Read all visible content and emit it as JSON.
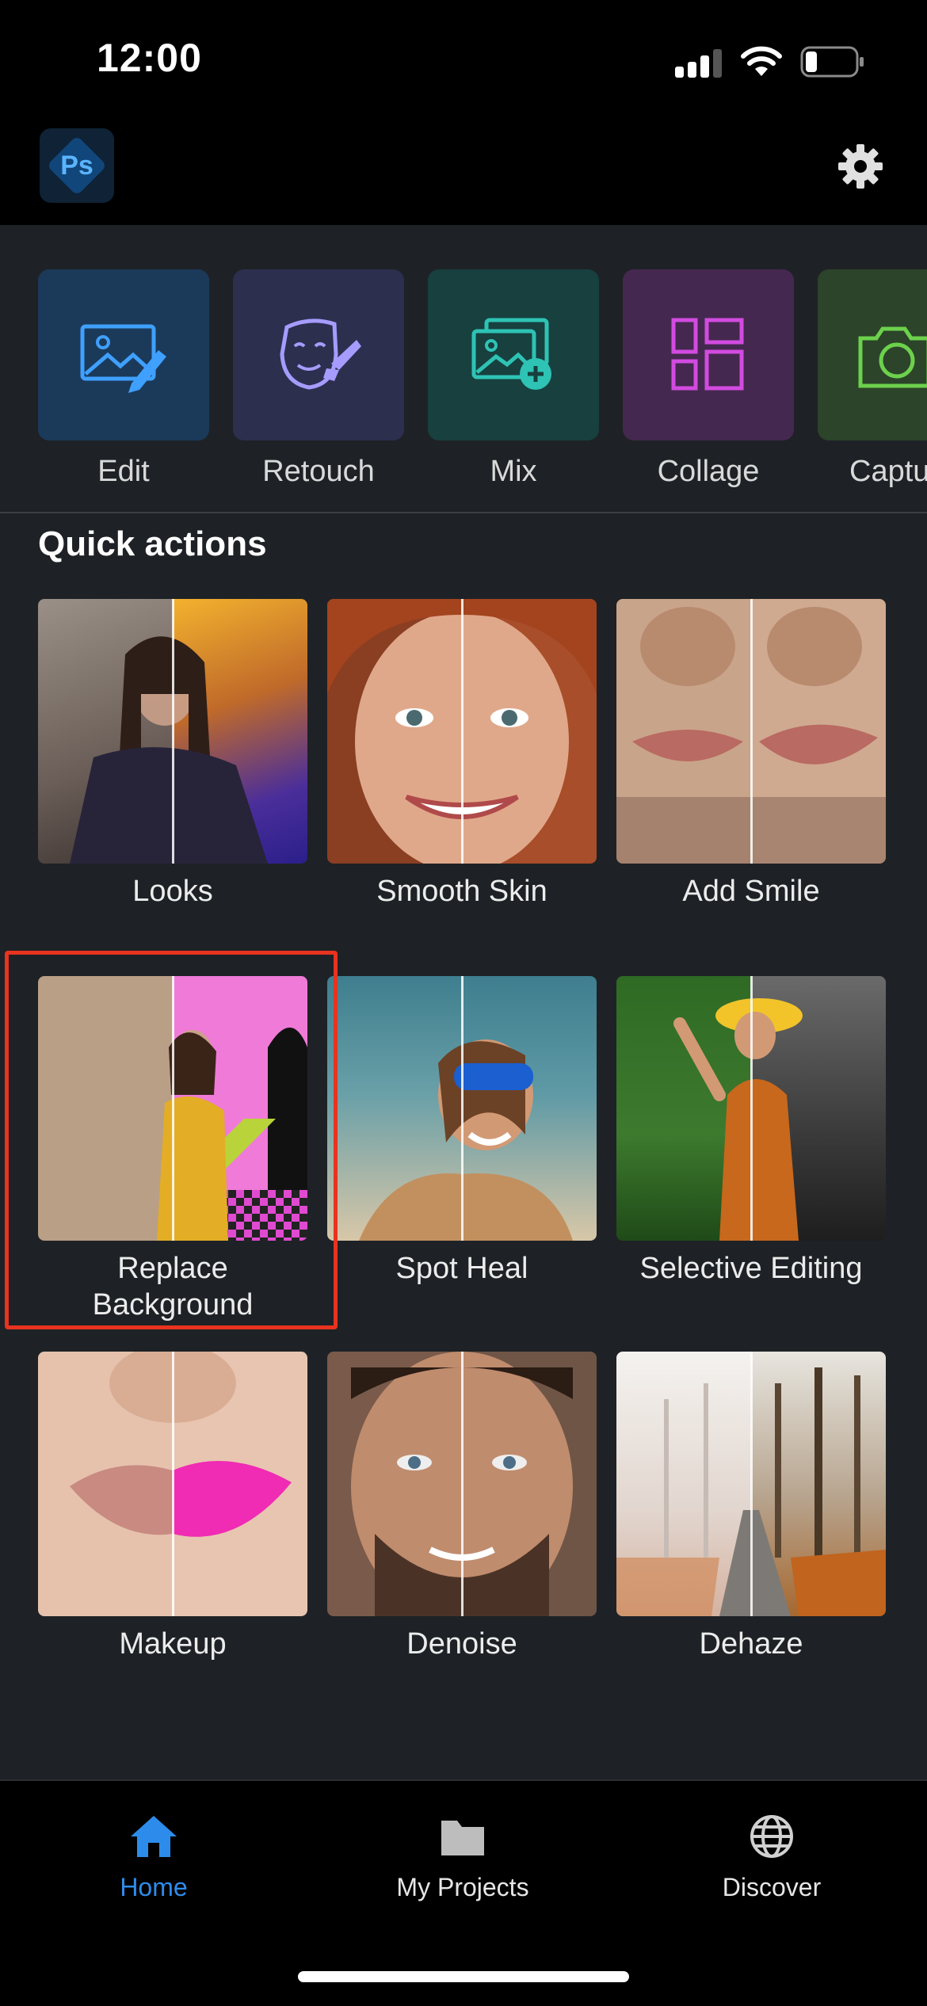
{
  "status_bar": {
    "time": "12:00"
  },
  "header": {
    "logo_text": "Ps"
  },
  "tools": [
    {
      "label": "Edit",
      "color": "#1b3a5a",
      "icon": "image-edit-icon"
    },
    {
      "label": "Retouch",
      "color": "#2d2f4f",
      "icon": "retouch-face-icon"
    },
    {
      "label": "Mix",
      "color": "#17403f",
      "icon": "image-add-icon"
    },
    {
      "label": "Collage",
      "color": "#45284f",
      "icon": "collage-grid-icon"
    },
    {
      "label": "Captu",
      "color": "#2c4429",
      "icon": "camera-icon"
    }
  ],
  "quick_actions": {
    "title": "Quick actions",
    "items": [
      {
        "label": "Looks"
      },
      {
        "label": "Smooth Skin"
      },
      {
        "label": "Add Smile"
      },
      {
        "label": "Replace Background"
      },
      {
        "label": "Spot Heal"
      },
      {
        "label": "Selective Editing"
      },
      {
        "label": "Makeup"
      },
      {
        "label": "Denoise"
      },
      {
        "label": "Dehaze"
      }
    ]
  },
  "tab_bar": {
    "tabs": [
      {
        "label": "Home",
        "active": true
      },
      {
        "label": "My Projects",
        "active": false
      },
      {
        "label": "Discover",
        "active": false
      }
    ]
  },
  "colors": {
    "accent": "#2d8ceb",
    "highlight": "#e8331f",
    "background": "#1e2226"
  }
}
